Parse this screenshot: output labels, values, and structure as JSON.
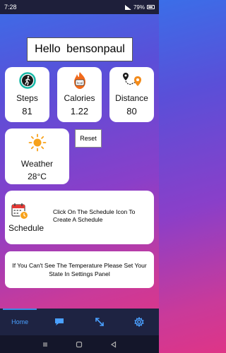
{
  "status": {
    "time": "7:28",
    "battery": "79%"
  },
  "greeting": "Hello  bensonpaul",
  "stats": [
    {
      "label": "Steps",
      "value": "81",
      "icon": "walking-icon"
    },
    {
      "label": "Calories",
      "value": "1.22",
      "icon": "kcal-icon"
    },
    {
      "label": "Distance",
      "value": "80",
      "icon": "route-pin-icon"
    }
  ],
  "weather": {
    "label": "Weather",
    "value": "28°C",
    "icon": "sun-icon"
  },
  "reset_label": "Reset",
  "schedule": {
    "label": "Schedule",
    "message": "Click On The Schedule Icon To Create A Schedule",
    "icon": "calendar-clock-icon"
  },
  "temperature_notice": "If You Can't See The Temperature Please Set Your State In Settings Panel",
  "nav": {
    "home_label": "Home",
    "items": [
      "home",
      "chat-icon",
      "expand-icon",
      "gear-icon"
    ]
  },
  "colors": {
    "accent": "#4aa0ff",
    "nav_bg": "#1e2342"
  }
}
